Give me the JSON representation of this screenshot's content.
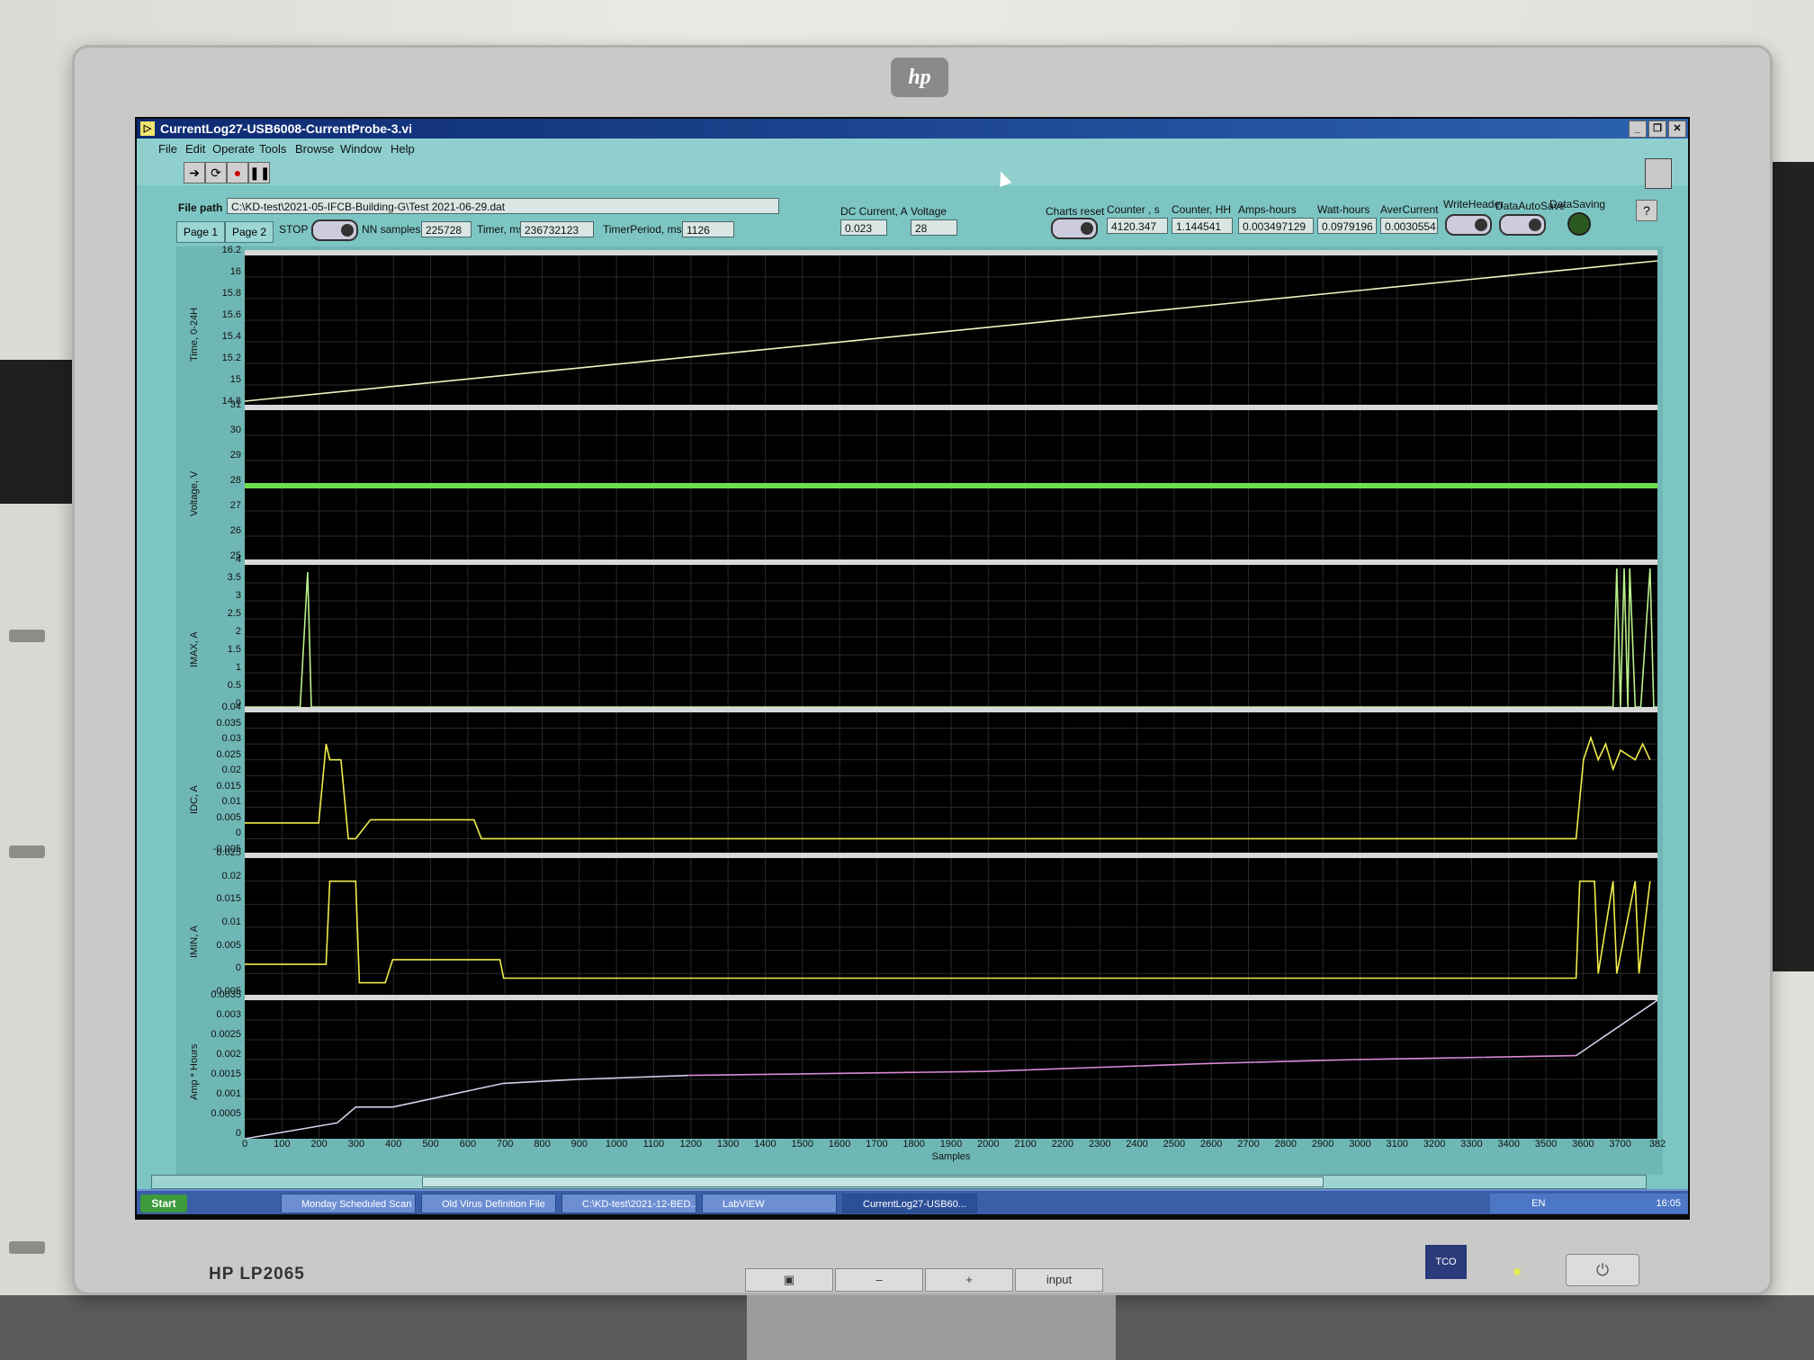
{
  "window": {
    "title": "CurrentLog27-USB6008-CurrentProbe-3.vi"
  },
  "menu": [
    "File",
    "Edit",
    "Operate",
    "Tools",
    "Browse",
    "Window",
    "Help"
  ],
  "controls": {
    "file_path_label": "File path",
    "file_path_value": "C:\\KD-test\\2021-05-IFCB-Building-G\\Test 2021-06-29.dat",
    "tab_page1": "Page 1",
    "tab_page2": "Page 2",
    "stop_label": "STOP",
    "nn_samples_label": "NN samples",
    "nn_samples_value": "225728",
    "timer_label": "Timer, ms",
    "timer_value": "236732123",
    "timer_period_label": "TimerPeriod, ms",
    "timer_period_value": "1126",
    "dc_current_label": "DC Current, A",
    "dc_current_value": "0.023",
    "voltage_label": "Voltage",
    "voltage_value": "28",
    "charts_reset_label": "Charts reset",
    "counter_s_label": "Counter , s",
    "counter_s_value": "4120.347",
    "counter_hh_label": "Counter, HH",
    "counter_hh_value": "1.144541",
    "amp_hours_label": "Amps-hours",
    "amp_hours_value": "0.003497129",
    "watt_hours_label": "Watt-hours",
    "watt_hours_value": "0.0979196",
    "aver_current_label": "AverCurrent",
    "aver_current_value": "0.0030554",
    "write_header_label": "WriteHeader",
    "data_autosave_label": "DataAutoSave",
    "data_saving_label": "DataSaving"
  },
  "chart_data": [
    {
      "type": "line",
      "ylabel": "Time, 0-24H",
      "ylim": [
        14.8,
        16.2
      ],
      "yticks": [
        "16.2",
        "16",
        "15.8",
        "15.6",
        "15.4",
        "15.2",
        "15",
        "14.8"
      ],
      "series": [
        {
          "color": "#f4f2c2",
          "x": [
            0,
            3820
          ],
          "y": [
            14.85,
            16.15
          ]
        }
      ]
    },
    {
      "type": "line",
      "ylabel": "Voltage, V",
      "ylim": [
        25,
        31
      ],
      "yticks": [
        "31",
        "30",
        "29",
        "28",
        "27",
        "26",
        "25"
      ],
      "series": [
        {
          "color": "#6be04a",
          "x": [
            0,
            3820
          ],
          "y": [
            28,
            28
          ]
        }
      ]
    },
    {
      "type": "line",
      "ylabel": "IMAX, A",
      "ylim": [
        0,
        4
      ],
      "yticks": [
        "4",
        "3.5",
        "3",
        "2.5",
        "2",
        "1.5",
        "1",
        "0.5",
        "0"
      ],
      "series": [
        {
          "color": "#b9f08a",
          "x": [
            0,
            150,
            170,
            180,
            3700,
            3710,
            3720,
            3730,
            3740,
            3745,
            3760,
            3770,
            3775,
            3800,
            3810,
            3820
          ],
          "y": [
            0.05,
            0.05,
            3.8,
            0.05,
            0.05,
            3.9,
            0.05,
            3.9,
            0.05,
            3.9,
            0.05,
            0.05,
            0.05,
            3.9,
            0.05,
            0.05
          ]
        }
      ]
    },
    {
      "type": "line",
      "ylabel": "IDC, A",
      "ylim": [
        -0.005,
        0.04
      ],
      "yticks": [
        "0.04",
        "0.035",
        "0.03",
        "0.025",
        "0.02",
        "0.015",
        "0.01",
        "0.005",
        "0",
        "-0.005"
      ],
      "series": [
        {
          "color": "#f0ec4a",
          "x": [
            0,
            200,
            220,
            230,
            260,
            280,
            300,
            340,
            350,
            620,
            640,
            3600,
            3620,
            3640,
            3660,
            3680,
            3700,
            3720,
            3760,
            3780,
            3800
          ],
          "y": [
            0.005,
            0.005,
            0.03,
            0.025,
            0.025,
            0.0,
            0.0,
            0.006,
            0.006,
            0.006,
            0.0,
            0.0,
            0.025,
            0.032,
            0.025,
            0.03,
            0.022,
            0.028,
            0.025,
            0.03,
            0.025
          ]
        }
      ]
    },
    {
      "type": "line",
      "ylabel": "IMIN, A",
      "ylim": [
        -0.005,
        0.025
      ],
      "yticks": [
        "0.025",
        "0.02",
        "0.015",
        "0.01",
        "0.005",
        "0",
        "-0.005"
      ],
      "series": [
        {
          "color": "#f0ec4a",
          "x": [
            0,
            220,
            230,
            300,
            310,
            380,
            400,
            690,
            700,
            3600,
            3610,
            3650,
            3660,
            3700,
            3710,
            3760,
            3770,
            3800
          ],
          "y": [
            0.002,
            0.002,
            0.02,
            0.02,
            -0.002,
            -0.002,
            0.003,
            0.003,
            -0.001,
            -0.001,
            0.02,
            0.02,
            0.0,
            0.02,
            0.0,
            0.02,
            0.0,
            0.02
          ]
        }
      ]
    },
    {
      "type": "line",
      "ylabel": "Amp * Hours",
      "xlabel": "Samples",
      "ylim": [
        0,
        0.0035
      ],
      "yticks": [
        "0.0035",
        "0.003",
        "0.0025",
        "0.002",
        "0.0015",
        "0.001",
        "0.0005",
        "0"
      ],
      "xticks": [
        "0",
        "100",
        "200",
        "300",
        "400",
        "500",
        "600",
        "700",
        "800",
        "900",
        "1000",
        "1100",
        "1200",
        "1300",
        "1400",
        "1500",
        "1600",
        "1700",
        "1800",
        "1900",
        "2000",
        "2100",
        "2200",
        "2300",
        "2400",
        "2500",
        "2600",
        "2700",
        "2800",
        "2900",
        "3000",
        "3100",
        "3200",
        "3300",
        "3400",
        "3500",
        "3600",
        "3700",
        "382"
      ],
      "series": [
        {
          "color": "#d0d0e8",
          "x": [
            0,
            250,
            300,
            400,
            700,
            900,
            1200
          ],
          "y": [
            0,
            0.0004,
            0.0008,
            0.0008,
            0.0014,
            0.0015,
            0.0016
          ]
        },
        {
          "color": "#d98ad6",
          "x": [
            1200,
            2000,
            2600,
            3000,
            3600
          ],
          "y": [
            0.0016,
            0.0017,
            0.0019,
            0.002,
            0.0021
          ]
        },
        {
          "color": "#d0d0e8",
          "x": [
            3600,
            3820
          ],
          "y": [
            0.0021,
            0.0035
          ]
        }
      ]
    }
  ],
  "taskbar": {
    "start": "Start",
    "items": [
      "Monday Scheduled Scan",
      "Old Virus Definition File",
      "C:\\KD-test\\2021-12-BED...",
      "LabVIEW",
      "CurrentLog27-USB60..."
    ],
    "lang": "EN",
    "clock": "16:05"
  },
  "monitor": {
    "brand": "hp",
    "model": "HP LP2065",
    "button_minus": "–",
    "button_plus": "+",
    "button_input": "input"
  }
}
